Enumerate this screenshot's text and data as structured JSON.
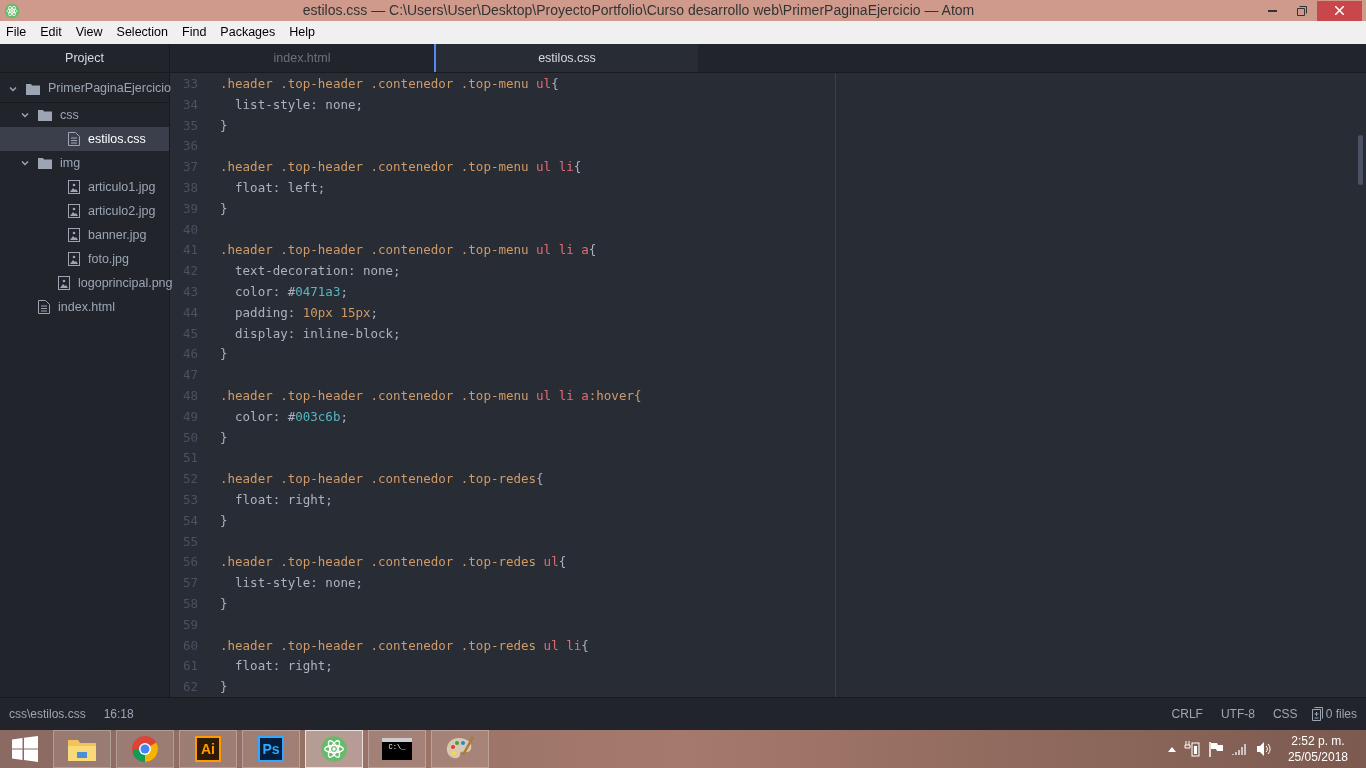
{
  "window": {
    "title": "estilos.css — C:\\Users\\User\\Desktop\\ProyectoPortfolio\\Curso desarrollo web\\PrimerPaginaEjercicio — Atom"
  },
  "menu": [
    "File",
    "Edit",
    "View",
    "Selection",
    "Find",
    "Packages",
    "Help"
  ],
  "sidebar": {
    "title": "Project",
    "tree": [
      {
        "label": "PrimerPaginaEjercicio",
        "kind": "folder",
        "expanded": true,
        "selected": false,
        "children": [
          {
            "label": "css",
            "kind": "folder",
            "expanded": true,
            "selected": false,
            "children": [
              {
                "label": "estilos.css",
                "kind": "text-file",
                "selected": true
              }
            ]
          },
          {
            "label": "img",
            "kind": "folder",
            "expanded": true,
            "selected": false,
            "children": [
              {
                "label": "articulo1.jpg",
                "kind": "image-file",
                "selected": false
              },
              {
                "label": "articulo2.jpg",
                "kind": "image-file",
                "selected": false
              },
              {
                "label": "banner.jpg",
                "kind": "image-file",
                "selected": false
              },
              {
                "label": "foto.jpg",
                "kind": "image-file",
                "selected": false
              },
              {
                "label": "logoprincipal.png",
                "kind": "image-file",
                "selected": false
              }
            ]
          },
          {
            "label": "index.html",
            "kind": "text-file",
            "selected": false
          }
        ]
      }
    ]
  },
  "tabs": [
    {
      "label": "index.html",
      "selected": false
    },
    {
      "label": "estilos.css",
      "selected": true
    }
  ],
  "editor": {
    "lines": [
      {
        "number": "33",
        "tokens": [
          {
            "t": ".header .top-header .contenedor .top-menu",
            "kind": "selector"
          },
          {
            "t": " ul",
            "kind": "tag"
          },
          {
            "t": "{",
            "kind": "punct"
          }
        ]
      },
      {
        "number": "34",
        "tokens": [
          {
            "t": "  list-style: none;",
            "kind": "plain"
          }
        ]
      },
      {
        "number": "35",
        "tokens": [
          {
            "t": "}",
            "kind": "punct"
          }
        ]
      },
      {
        "number": "36"
      },
      {
        "number": "37",
        "tokens": [
          {
            "t": ".header .top-header .contenedor .top-menu",
            "kind": "selector"
          },
          {
            "t": " ul li",
            "kind": "tag"
          },
          {
            "t": "{",
            "kind": "punct"
          }
        ]
      },
      {
        "number": "38",
        "tokens": [
          {
            "t": "  float: left;",
            "kind": "plain"
          }
        ]
      },
      {
        "number": "39",
        "tokens": [
          {
            "t": "}",
            "kind": "punct"
          }
        ]
      },
      {
        "number": "40"
      },
      {
        "number": "41",
        "tokens": [
          {
            "t": ".header .top-header .contenedor .top-menu",
            "kind": "selector"
          },
          {
            "t": " ul li a",
            "kind": "tag"
          },
          {
            "t": "{",
            "kind": "punct"
          }
        ]
      },
      {
        "number": "42",
        "tokens": [
          {
            "t": "  text-decoration: none;",
            "kind": "plain"
          }
        ]
      },
      {
        "number": "43",
        "tokens": [
          {
            "t": "  color: #",
            "kind": "plain"
          },
          {
            "t": "0471a3",
            "kind": "hex"
          },
          {
            "t": ";",
            "kind": "plain"
          }
        ]
      },
      {
        "number": "44",
        "tokens": [
          {
            "t": "  padding: ",
            "kind": "plain"
          },
          {
            "t": "10px 15px",
            "kind": "number"
          },
          {
            "t": ";",
            "kind": "plain"
          }
        ]
      },
      {
        "number": "45",
        "tokens": [
          {
            "t": "  display: inline-block;",
            "kind": "plain"
          }
        ]
      },
      {
        "number": "46",
        "tokens": [
          {
            "t": "}",
            "kind": "punct"
          }
        ]
      },
      {
        "number": "47"
      },
      {
        "number": "48",
        "tokens": [
          {
            "t": ".header .top-header .contenedor .top-menu",
            "kind": "selector"
          },
          {
            "t": " ul li a",
            "kind": "tag"
          },
          {
            "t": ":hover{",
            "kind": "selector"
          }
        ]
      },
      {
        "number": "49",
        "tokens": [
          {
            "t": "  color: #",
            "kind": "plain"
          },
          {
            "t": "003c6b",
            "kind": "hex"
          },
          {
            "t": ";",
            "kind": "plain"
          }
        ]
      },
      {
        "number": "50",
        "tokens": [
          {
            "t": "}",
            "kind": "punct"
          }
        ]
      },
      {
        "number": "51"
      },
      {
        "number": "52",
        "tokens": [
          {
            "t": ".header .top-header .contenedor .top-redes",
            "kind": "selector"
          },
          {
            "t": "{",
            "kind": "punct"
          }
        ]
      },
      {
        "number": "53",
        "tokens": [
          {
            "t": "  float: right;",
            "kind": "plain"
          }
        ]
      },
      {
        "number": "54",
        "tokens": [
          {
            "t": "}",
            "kind": "punct"
          }
        ]
      },
      {
        "number": "55"
      },
      {
        "number": "56",
        "tokens": [
          {
            "t": ".header .top-header .contenedor .top-redes",
            "kind": "selector"
          },
          {
            "t": " ul",
            "kind": "tag"
          },
          {
            "t": "{",
            "kind": "punct"
          }
        ]
      },
      {
        "number": "57",
        "tokens": [
          {
            "t": "  list-style: none;",
            "kind": "plain"
          }
        ]
      },
      {
        "number": "58",
        "tokens": [
          {
            "t": "}",
            "kind": "punct"
          }
        ]
      },
      {
        "number": "59"
      },
      {
        "number": "60",
        "tokens": [
          {
            "t": ".header .top-header .contenedor .top-redes",
            "kind": "selector"
          },
          {
            "t": " ul li",
            "kind": "tag"
          },
          {
            "t": "{",
            "kind": "punct"
          }
        ]
      },
      {
        "number": "61",
        "tokens": [
          {
            "t": "  float: right;",
            "kind": "plain"
          }
        ]
      },
      {
        "number": "62",
        "tokens": [
          {
            "t": "}",
            "kind": "punct"
          }
        ]
      }
    ]
  },
  "status_bar": {
    "path": "css\\estilos.css",
    "cursor": "16:18",
    "line_ending": "CRLF",
    "encoding": "UTF-8",
    "grammar": "CSS",
    "files": "0 files"
  },
  "taskbar": {
    "apps": [
      {
        "kind": "explorer",
        "selected": false
      },
      {
        "kind": "chrome",
        "selected": false
      },
      {
        "kind": "illustrator",
        "label": "Ai",
        "selected": false
      },
      {
        "kind": "photoshop",
        "label": "Ps",
        "selected": false
      },
      {
        "kind": "atom",
        "selected": true
      },
      {
        "kind": "cmd",
        "label": "C:\\_",
        "selected": false
      },
      {
        "kind": "paint",
        "selected": false
      }
    ],
    "time": "2:52 p. m.",
    "date": "25/05/2018"
  }
}
